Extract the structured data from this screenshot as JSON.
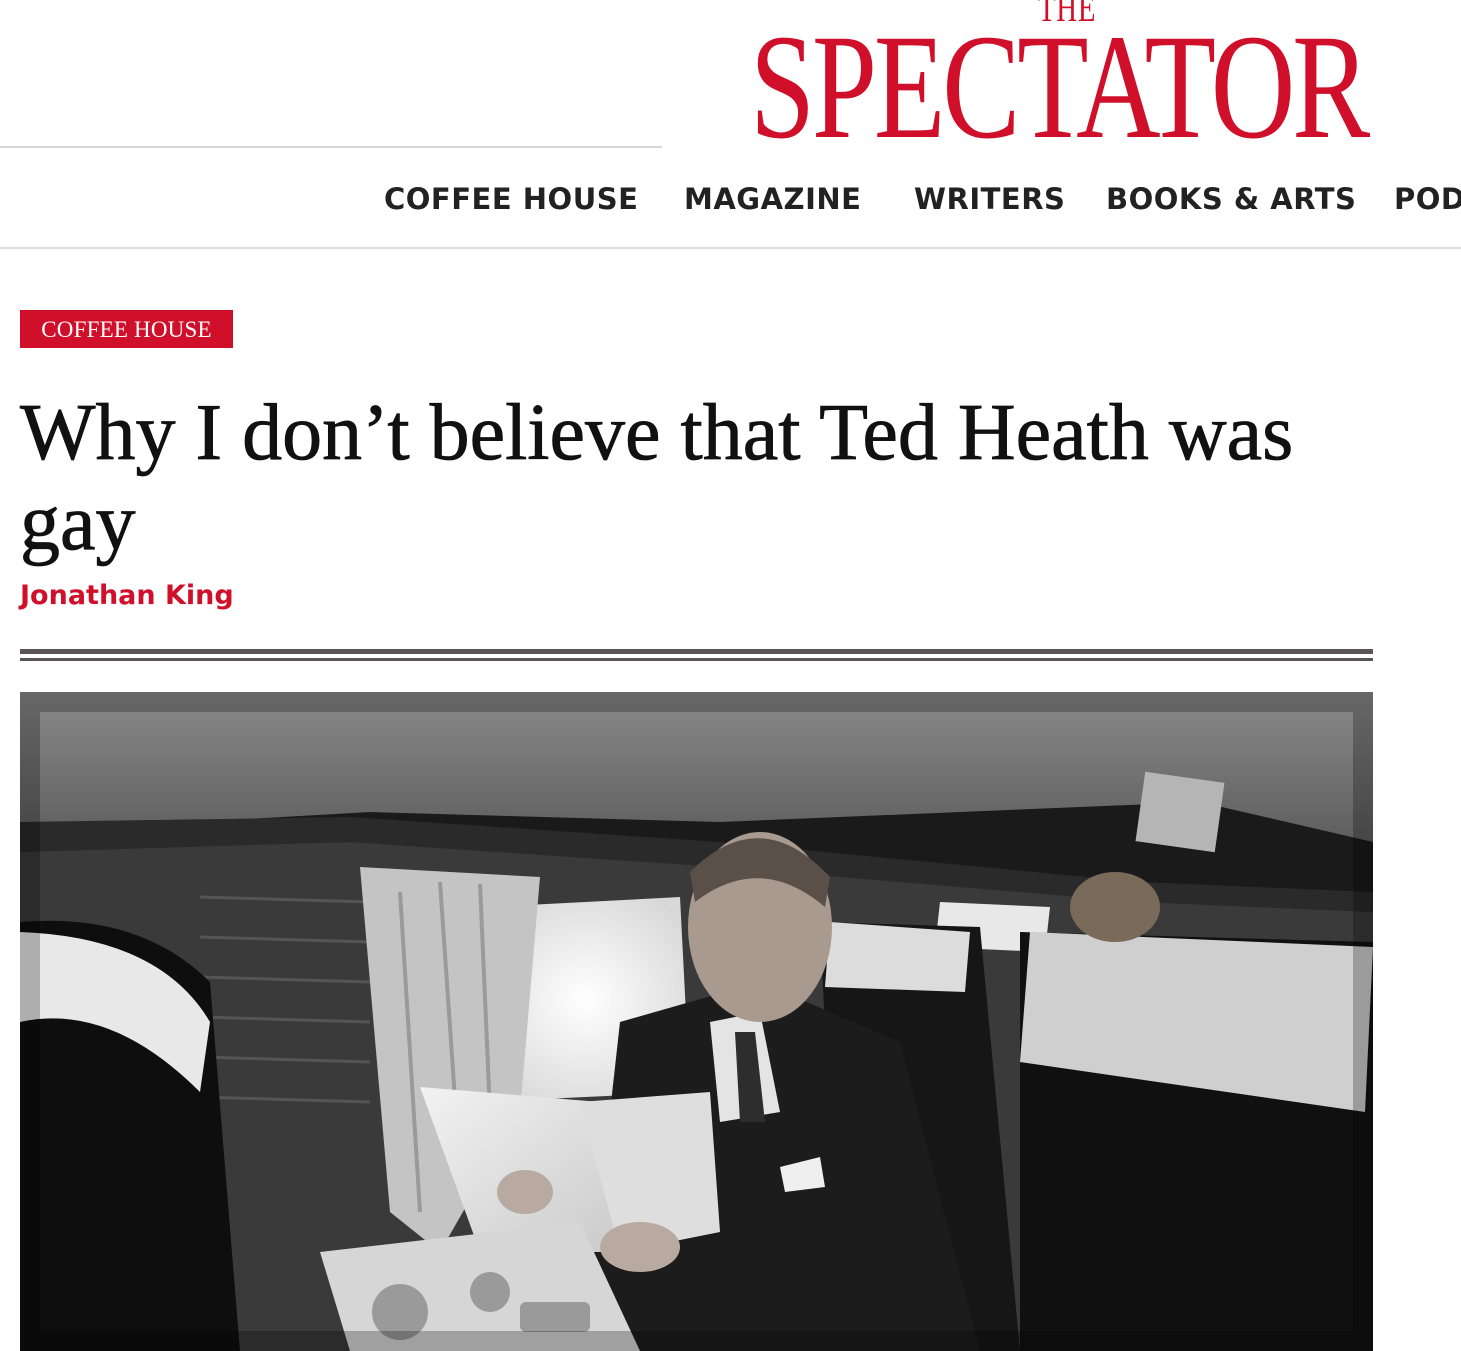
{
  "brand": {
    "logo_small": "THE",
    "logo_main": "SPECTATOR",
    "accent_color": "#d0102a"
  },
  "nav": {
    "items": [
      {
        "label": "COFFEE HOUSE"
      },
      {
        "label": "MAGAZINE"
      },
      {
        "label": "WRITERS"
      },
      {
        "label": "BOOKS & ARTS"
      },
      {
        "label": "POD"
      }
    ]
  },
  "article": {
    "section": "COFFEE HOUSE",
    "title": "Why I don’t believe that Ted Heath was gay",
    "author": "Jonathan King",
    "image": {
      "description_icon": "photo-icon"
    }
  }
}
